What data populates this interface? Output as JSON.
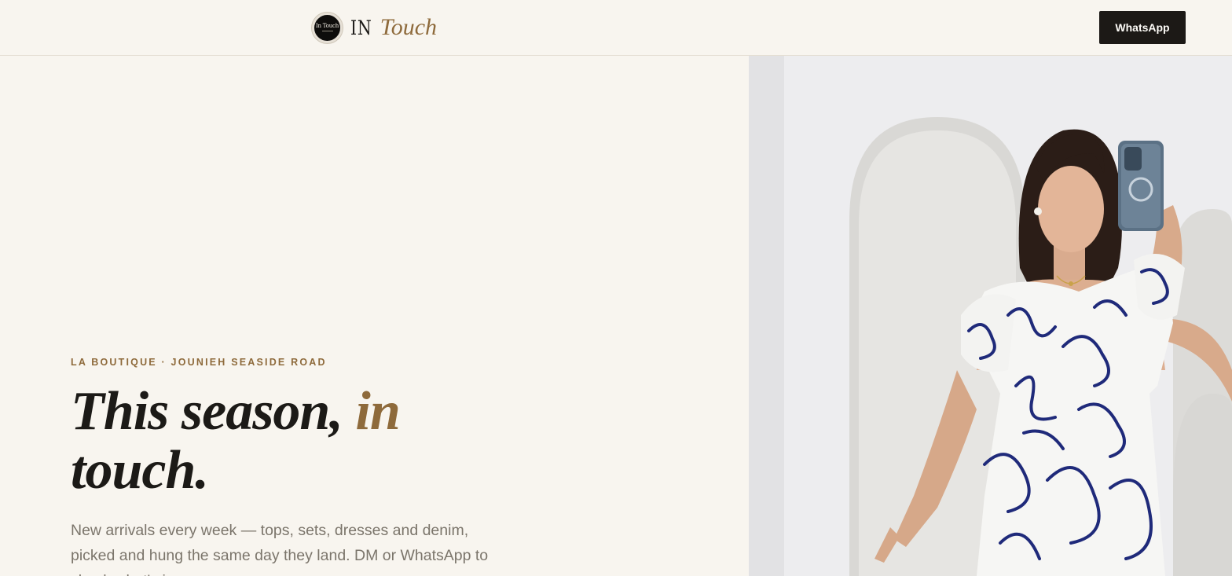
{
  "header": {
    "logo_badge_text": "In Touch",
    "wordmark_prefix": "IN",
    "wordmark_suffix": "Touch",
    "whatsapp_label": "WhatsApp"
  },
  "hero": {
    "eyebrow": "LA BOUTIQUE · JOUNIEH SEASIDE ROAD",
    "headline_part1": "This season, ",
    "headline_accent": "in",
    "headline_part2": "touch.",
    "lede": "New arrivals every week — tops, sets, dresses and denim, picked and hung the same day they land. DM or WhatsApp to check what's in."
  },
  "colors": {
    "background": "#f8f5ef",
    "accent": "#8e6a3b",
    "ink": "#1c1a17",
    "button": "#1c1916"
  }
}
